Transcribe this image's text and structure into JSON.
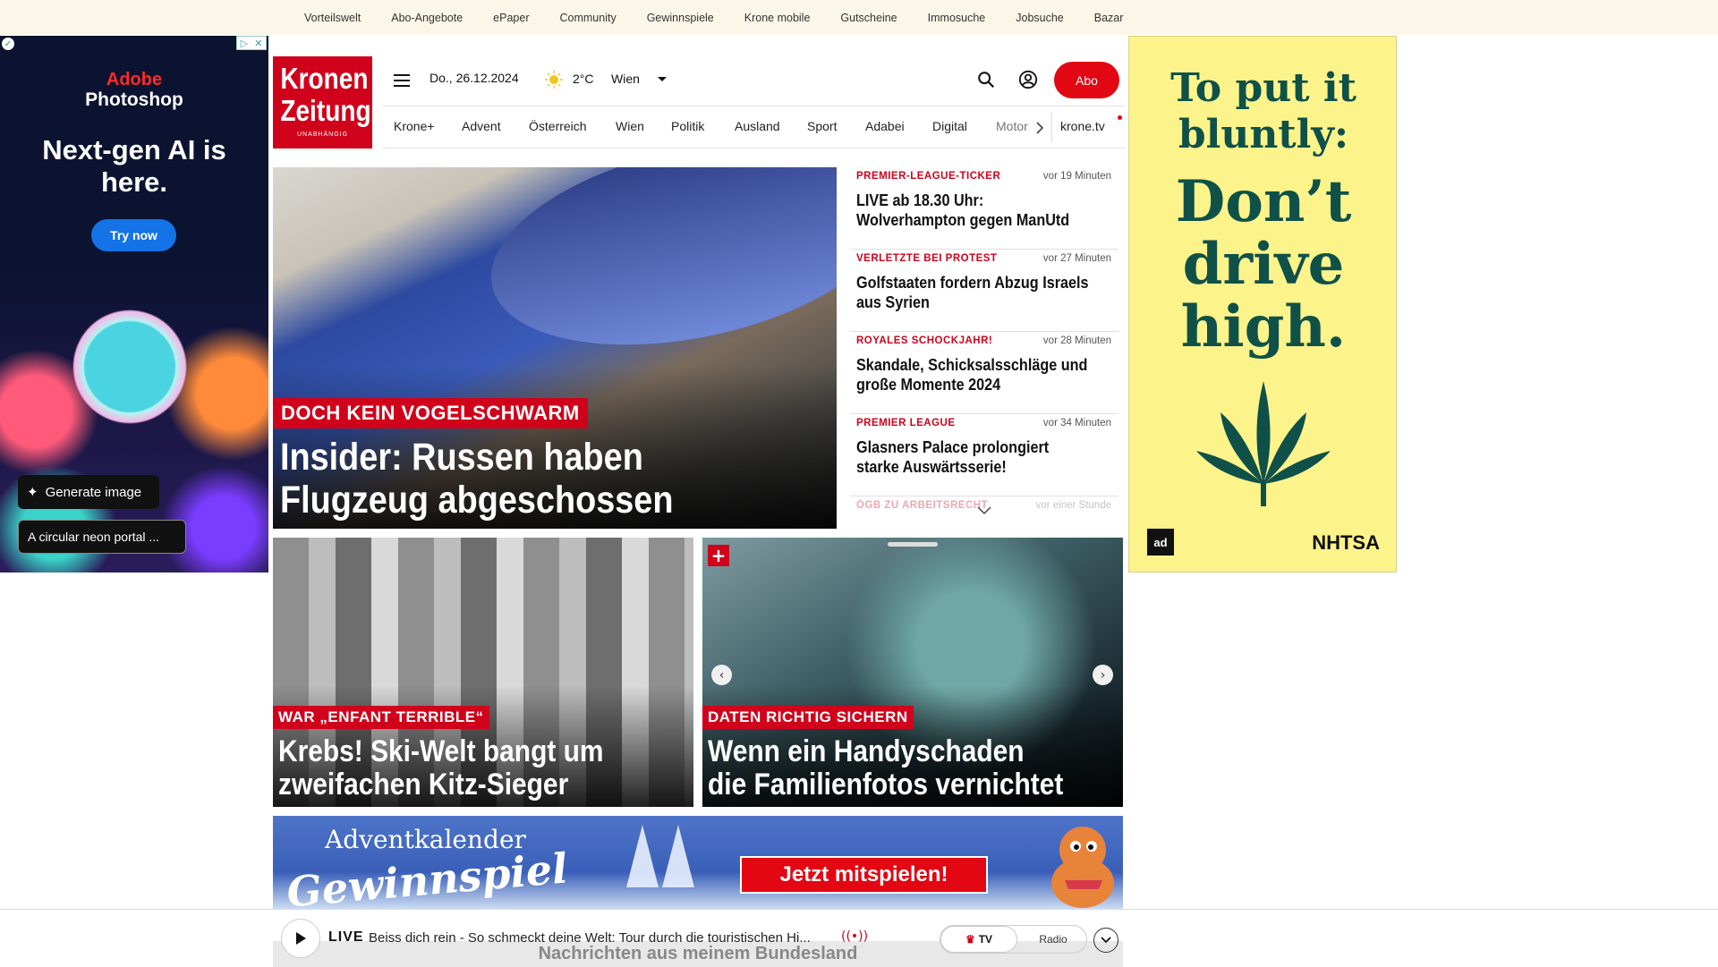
{
  "topnav": [
    "Vorteilswelt",
    "Abo-Angebote",
    "ePaper",
    "Community",
    "Gewinnspiele",
    "Krone mobile",
    "Gutscheine",
    "Immosuche",
    "Jobsuche",
    "Bazar"
  ],
  "ad_left": {
    "brand": "Adobe",
    "product": "Photoshop",
    "headline": "Next-gen AI is here.",
    "cta": "Try now",
    "generate": "Generate image",
    "prompt": "A circular neon portal ..."
  },
  "ad_right": {
    "line1": "To put it bluntly:",
    "line2": "Don’t drive high.",
    "logo_left": "ad",
    "logo_right": "NHTSA"
  },
  "header": {
    "logo_line1": "Kronen",
    "logo_line2": "Zeitung",
    "logo_tagline": "UNABHÄNGIG",
    "date": "Do., 26.12.2024",
    "temperature": "2°C",
    "city": "Wien",
    "abo_label": "Abo"
  },
  "nav": [
    "Krone+",
    "Advent",
    "Österreich",
    "Wien",
    "Politik",
    "Ausland",
    "Sport",
    "Adabei",
    "Digital",
    "Motor",
    "krone.tv"
  ],
  "hero": {
    "kicker": "DOCH KEIN VOGELSCHWARM",
    "title": "Insider: Russen haben Flugzeug abgeschossen"
  },
  "news": [
    {
      "kicker": "PREMIER-LEAGUE-TICKER",
      "time": "vor 19 Minuten",
      "title": "LIVE ab 18.30 Uhr: Wolverhampton gegen ManUtd"
    },
    {
      "kicker": "VERLETZTE BEI PROTEST",
      "time": "vor 27 Minuten",
      "title": "Golfstaaten fordern Abzug Israels aus Syrien"
    },
    {
      "kicker": "ROYALES SCHOCKJAHR!",
      "time": "vor 28 Minuten",
      "title": "Skandale, Schicksalsschläge und große Momente 2024"
    },
    {
      "kicker": "PREMIER LEAGUE",
      "time": "vor 34 Minuten",
      "title": "Glasners Palace prolongiert starke Auswärtsserie!"
    },
    {
      "kicker": "ÖGB ZU ARBEITSRECHT",
      "time": "vor einer Stunde",
      "title": ""
    }
  ],
  "cards": [
    {
      "kicker": "WAR „ENFANT TERRIBLE“",
      "title": "Krebs! Ski-Welt bangt um zweifachen Kitz-Sieger"
    },
    {
      "kicker": "DATEN RICHTIG SICHERN",
      "title": "Wenn ein Handyschaden die Familienfotos vernichtet",
      "plus": "+"
    }
  ],
  "banner": {
    "line1": "Adventkalender",
    "line2": "Gewinnspiel",
    "cta": "Jetzt mitspielen!"
  },
  "player": {
    "live": "LIVE",
    "description": "Beiss dich rein - So schmeckt deine Welt: Tour durch die touristischen Hi...",
    "tv": "TV",
    "radio": "Radio",
    "underlay": "Nachrichten aus meinem Bundesland"
  },
  "colors": {
    "brand_red": "#d0021b",
    "topbar_bg": "#fbf7e8",
    "ad_yellow": "#fcf38b",
    "ad_green": "#0f5148"
  }
}
